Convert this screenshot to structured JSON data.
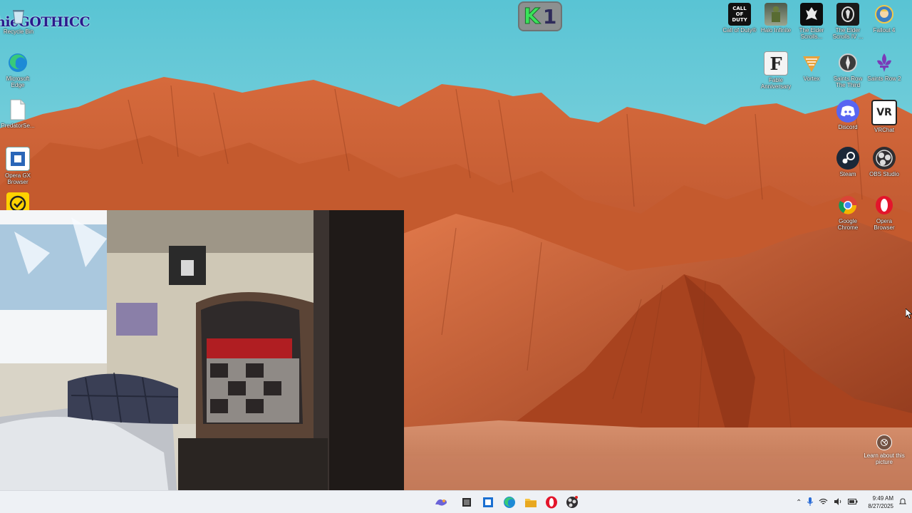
{
  "overlay": {
    "streamer_tag": "hieGOTHICC",
    "badge_k": "K",
    "badge_1": "1"
  },
  "desktop": {
    "left_icons": [
      {
        "name": "recycle-bin",
        "label": "Recycle Bin"
      },
      {
        "name": "microsoft-edge",
        "label": "Microsoft Edge"
      },
      {
        "name": "predator-sense",
        "label": "PredatorSe..."
      },
      {
        "name": "opera-gx",
        "label": "Opera GX Browser"
      },
      {
        "name": "norton",
        "label": ""
      }
    ],
    "right_icons": [
      {
        "name": "call-of-duty",
        "label": "Call of Duty®",
        "glyph": "CALL OF DUTY"
      },
      {
        "name": "halo-infinite",
        "label": "Halo Infinite"
      },
      {
        "name": "elder-scrolls-v",
        "label": "The Elder Scrolls..."
      },
      {
        "name": "elder-scrolls-iv",
        "label": "The Elder Scrolls IV ..."
      },
      {
        "name": "fallout-4",
        "label": "Fallout 4"
      },
      {
        "name": "fable-anniversary",
        "label": "Fable Anniversary",
        "glyph": "F"
      },
      {
        "name": "vortex",
        "label": "Vortex"
      },
      {
        "name": "saints-row-third",
        "label": "Saints Row The Third"
      },
      {
        "name": "saints-row-2",
        "label": "Saints Row 2"
      },
      {
        "name": "discord",
        "label": "Discord"
      },
      {
        "name": "vrchat",
        "label": "VRChat",
        "glyph": "VR"
      },
      {
        "name": "steam",
        "label": "Steam"
      },
      {
        "name": "obs-studio",
        "label": "OBS Studio"
      },
      {
        "name": "google-chrome",
        "label": "Google Chrome"
      },
      {
        "name": "opera-browser",
        "label": "Opera Browser"
      }
    ],
    "learn_about_picture": "Learn about this picture"
  },
  "taskbar": {
    "clock_time": "9:49 AM",
    "clock_date": "8/27/2025"
  },
  "colors": {
    "sky": "#6fc8d8",
    "rock": "#c85a30",
    "taskbar": "#eef1f5"
  }
}
